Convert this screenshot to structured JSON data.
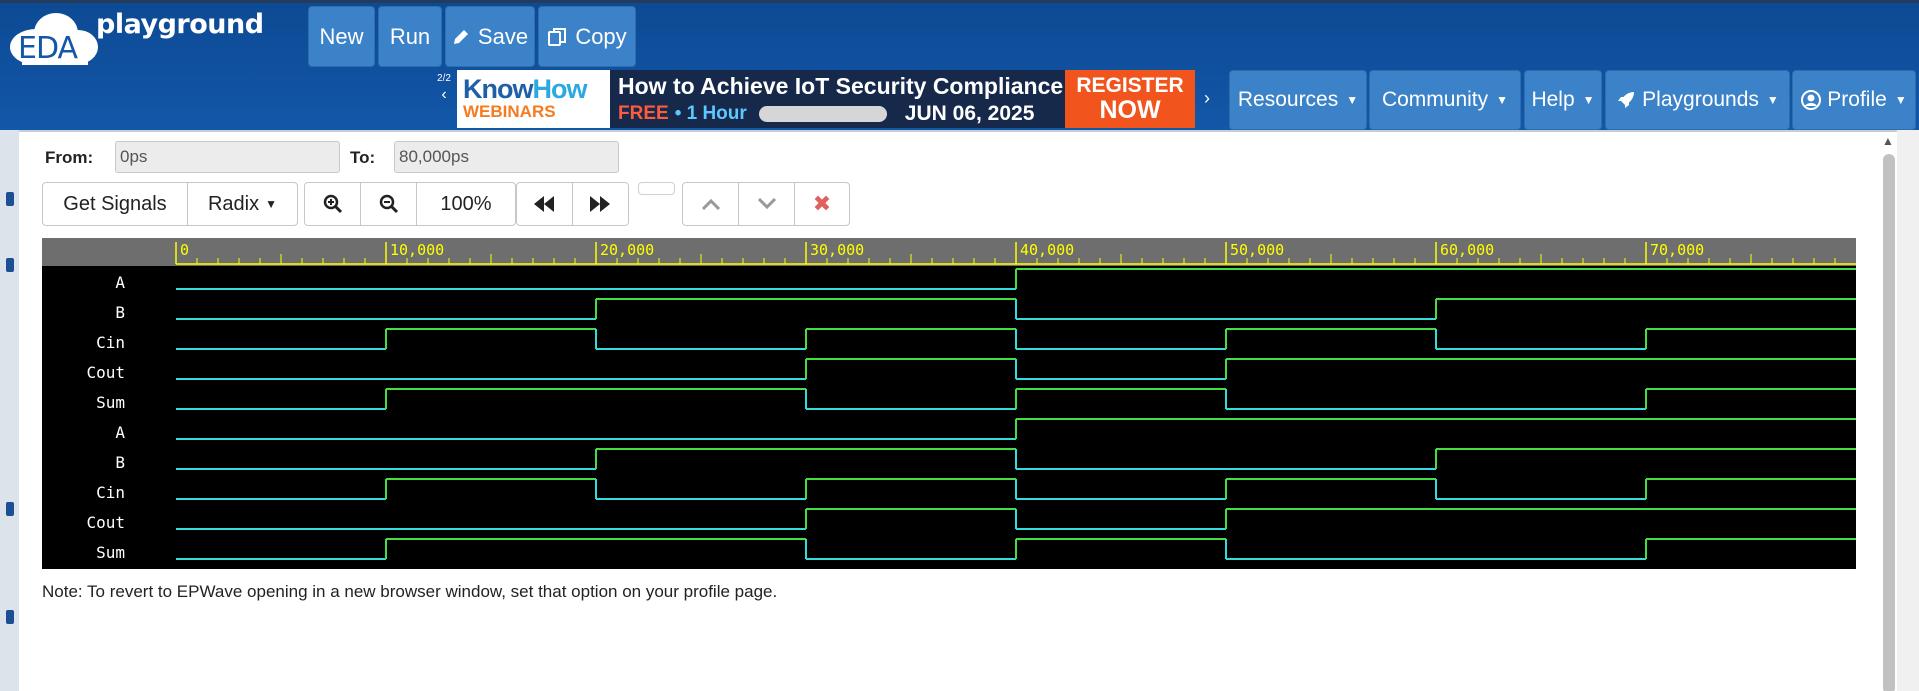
{
  "navbar": {
    "logo_eda": "EDA",
    "logo_text": "playground",
    "buttons": {
      "new": "New",
      "run": "Run",
      "save": "Save",
      "copy": "Copy"
    },
    "pager": "2/2",
    "menus": {
      "resources": "Resources",
      "community": "Community",
      "help": "Help",
      "playgrounds": "Playgrounds",
      "profile": "Profile"
    }
  },
  "banner": {
    "brand_know": "Know",
    "brand_how": "How",
    "brand_sub": "WEBINARS",
    "title": "How to Achieve IoT Security Compliance",
    "free": "FREE",
    "hour": "• 1 Hour",
    "date": "JUN 06, 2025",
    "register1": "REGISTER",
    "register2": "NOW"
  },
  "range": {
    "from_label": "From:",
    "from_value": "0ps",
    "to_label": "To:",
    "to_value": "80,000ps"
  },
  "toolbar": {
    "get_signals": "Get Signals",
    "radix": "Radix",
    "zoom": "100%"
  },
  "note": "Note: To revert to EPWave opening in a new browser window, set that option on your profile page.",
  "waveform": {
    "time_end": 80000,
    "ticks": [
      "0",
      "10,000",
      "20,000",
      "30,000",
      "40,000",
      "50,000",
      "60,000",
      "70,000"
    ],
    "colors": {
      "high": "#44dd44",
      "low": "#33dddd",
      "ruler_text": "#ffff00",
      "bg": "#000000"
    },
    "signals": [
      {
        "name": "A",
        "changes": [
          [
            0,
            0
          ],
          [
            40000,
            1
          ]
        ]
      },
      {
        "name": "B",
        "changes": [
          [
            0,
            0
          ],
          [
            20000,
            1
          ],
          [
            40000,
            0
          ],
          [
            60000,
            1
          ]
        ]
      },
      {
        "name": "Cin",
        "changes": [
          [
            0,
            0
          ],
          [
            10000,
            1
          ],
          [
            20000,
            0
          ],
          [
            30000,
            1
          ],
          [
            40000,
            0
          ],
          [
            50000,
            1
          ],
          [
            60000,
            0
          ],
          [
            70000,
            1
          ]
        ]
      },
      {
        "name": "Cout",
        "changes": [
          [
            0,
            0
          ],
          [
            30000,
            1
          ],
          [
            40000,
            0
          ],
          [
            50000,
            1
          ]
        ]
      },
      {
        "name": "Sum",
        "changes": [
          [
            0,
            0
          ],
          [
            10000,
            1
          ],
          [
            30000,
            0
          ],
          [
            40000,
            1
          ],
          [
            50000,
            0
          ],
          [
            70000,
            1
          ]
        ]
      },
      {
        "name": "A",
        "changes": [
          [
            0,
            0
          ],
          [
            40000,
            1
          ]
        ]
      },
      {
        "name": "B",
        "changes": [
          [
            0,
            0
          ],
          [
            20000,
            1
          ],
          [
            40000,
            0
          ],
          [
            60000,
            1
          ]
        ]
      },
      {
        "name": "Cin",
        "changes": [
          [
            0,
            0
          ],
          [
            10000,
            1
          ],
          [
            20000,
            0
          ],
          [
            30000,
            1
          ],
          [
            40000,
            0
          ],
          [
            50000,
            1
          ],
          [
            60000,
            0
          ],
          [
            70000,
            1
          ]
        ]
      },
      {
        "name": "Cout",
        "changes": [
          [
            0,
            0
          ],
          [
            30000,
            1
          ],
          [
            40000,
            0
          ],
          [
            50000,
            1
          ]
        ]
      },
      {
        "name": "Sum",
        "changes": [
          [
            0,
            0
          ],
          [
            10000,
            1
          ],
          [
            30000,
            0
          ],
          [
            40000,
            1
          ],
          [
            50000,
            0
          ],
          [
            70000,
            1
          ]
        ]
      }
    ]
  }
}
